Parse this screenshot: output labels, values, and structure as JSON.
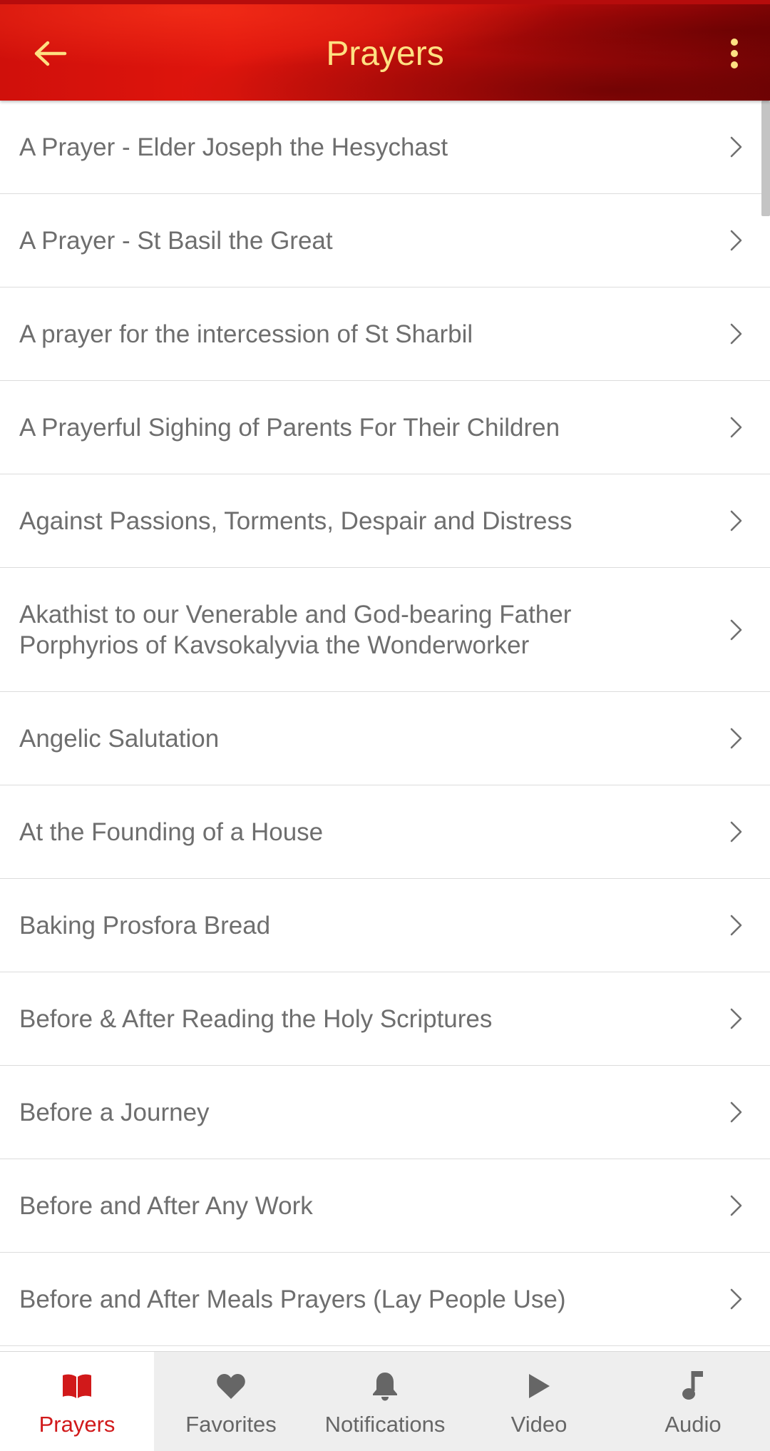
{
  "header": {
    "title": "Prayers",
    "back_icon": "arrow-left-icon",
    "menu_icon": "more-vertical-icon",
    "text_color": "#ffe082",
    "background_color": "#c70d0a"
  },
  "prayers": {
    "items": [
      {
        "label": "A Prayer - Elder Joseph the Hesychast"
      },
      {
        "label": "A Prayer - St Basil the Great"
      },
      {
        "label": "A prayer for the intercession of St Sharbil"
      },
      {
        "label": "A Prayerful Sighing of Parents For Their Children"
      },
      {
        "label": "Against Passions, Torments, Despair and Distress"
      },
      {
        "label": "Akathist to our Venerable and God-bearing Father Porphyrios of Kavsokalyvia the Wonderworker"
      },
      {
        "label": "Angelic Salutation"
      },
      {
        "label": "At the Founding of a House"
      },
      {
        "label": "Baking Prosfora Bread"
      },
      {
        "label": "Before & After Reading the Holy Scriptures"
      },
      {
        "label": "Before a Journey"
      },
      {
        "label": "Before and After Any Work"
      },
      {
        "label": "Before and After Meals Prayers (Lay People Use)"
      }
    ],
    "item_icon": "chevron-right-icon"
  },
  "bottom_nav": {
    "active_color": "#d1191a",
    "inactive_color": "#666666",
    "items": [
      {
        "label": "Prayers",
        "icon": "book-icon",
        "active": true
      },
      {
        "label": "Favorites",
        "icon": "heart-icon",
        "active": false
      },
      {
        "label": "Notifications",
        "icon": "bell-icon",
        "active": false
      },
      {
        "label": "Video",
        "icon": "play-icon",
        "active": false
      },
      {
        "label": "Audio",
        "icon": "music-note-icon",
        "active": false
      }
    ]
  }
}
